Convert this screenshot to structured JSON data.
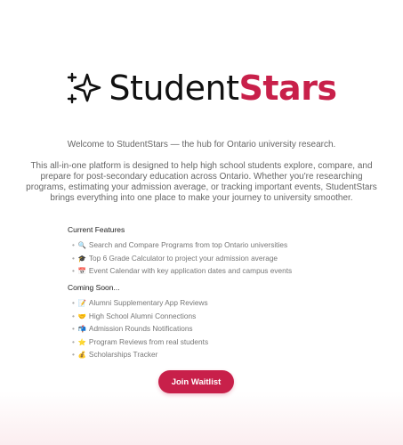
{
  "brand": {
    "name_part1": "Student",
    "name_part2": "Stars"
  },
  "welcome": "Welcome to StudentStars — the hub for Ontario university research.",
  "description": "This all-in-one platform is designed to help high school students explore, compare, and prepare for post-secondary education across Ontario. Whether you're researching programs, estimating your admission average, or tracking important events, StudentStars brings everything into one place to make your journey to university smoother.",
  "current_features": {
    "heading": "Current Features",
    "items": [
      {
        "emoji": "🔍",
        "text": "Search and Compare Programs from top Ontario universities"
      },
      {
        "emoji": "🎓",
        "text": "Top 6 Grade Calculator to project your admission average"
      },
      {
        "emoji": "📅",
        "text": "Event Calendar with key application dates and campus events"
      }
    ]
  },
  "coming_soon": {
    "heading": "Coming Soon...",
    "items": [
      {
        "emoji": "📝",
        "text": "Alumni Supplementary App Reviews"
      },
      {
        "emoji": "🤝",
        "text": "High School Alumni Connections"
      },
      {
        "emoji": "📬",
        "text": "Admission Rounds Notifications"
      },
      {
        "emoji": "⭐",
        "text": "Program Reviews from real students"
      },
      {
        "emoji": "💰",
        "text": "Scholarships Tracker"
      }
    ]
  },
  "cta": {
    "label": "Join Waitlist"
  },
  "colors": {
    "accent": "#c8204a",
    "text_dark": "#111111"
  }
}
